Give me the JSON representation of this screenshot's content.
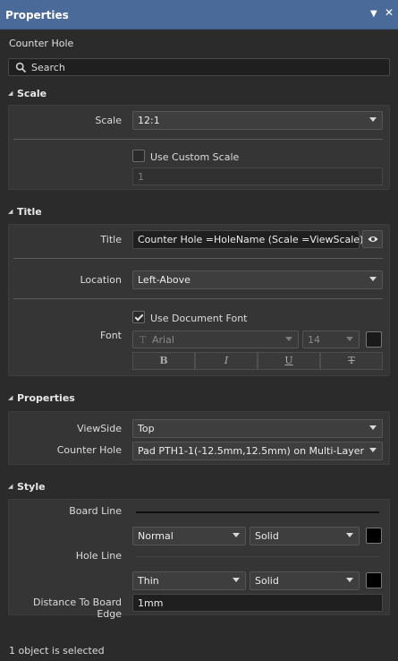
{
  "window": {
    "title": "Properties"
  },
  "object_type": "Counter Hole",
  "search": {
    "placeholder": "Search"
  },
  "sections": {
    "scale": "Scale",
    "title": "Title",
    "properties": "Properties",
    "style": "Style"
  },
  "scale": {
    "label": "Scale",
    "value": "12:1",
    "use_custom_label": "Use Custom Scale",
    "use_custom_checked": false,
    "custom_value": "1"
  },
  "title": {
    "title_label": "Title",
    "title_value": "Counter Hole =HoleName (Scale =ViewScale)",
    "location_label": "Location",
    "location_value": "Left-Above",
    "font_label": "Font",
    "use_doc_font_label": "Use Document Font",
    "use_doc_font_checked": true,
    "font_name": "Arial",
    "font_name_prefix": "T",
    "font_size": "14",
    "font_color": "#000000",
    "format_buttons": [
      "B",
      "I",
      "U",
      "T"
    ]
  },
  "properties": {
    "viewside_label": "ViewSide",
    "viewside_value": "Top",
    "counterhole_label": "Counter Hole",
    "counterhole_value": "Pad PTH1-1(-12.5mm,12.5mm) on Multi-Layer"
  },
  "style": {
    "board_line_label": "Board Line",
    "board_line_weight": "Normal",
    "board_line_style": "Solid",
    "board_line_color": "#000000",
    "hole_line_label": "Hole Line",
    "hole_line_weight": "Thin",
    "hole_line_style": "Solid",
    "hole_line_color": "#000000",
    "distance_label": "Distance To Board Edge",
    "distance_value": "1mm"
  },
  "status": "1 object is selected"
}
